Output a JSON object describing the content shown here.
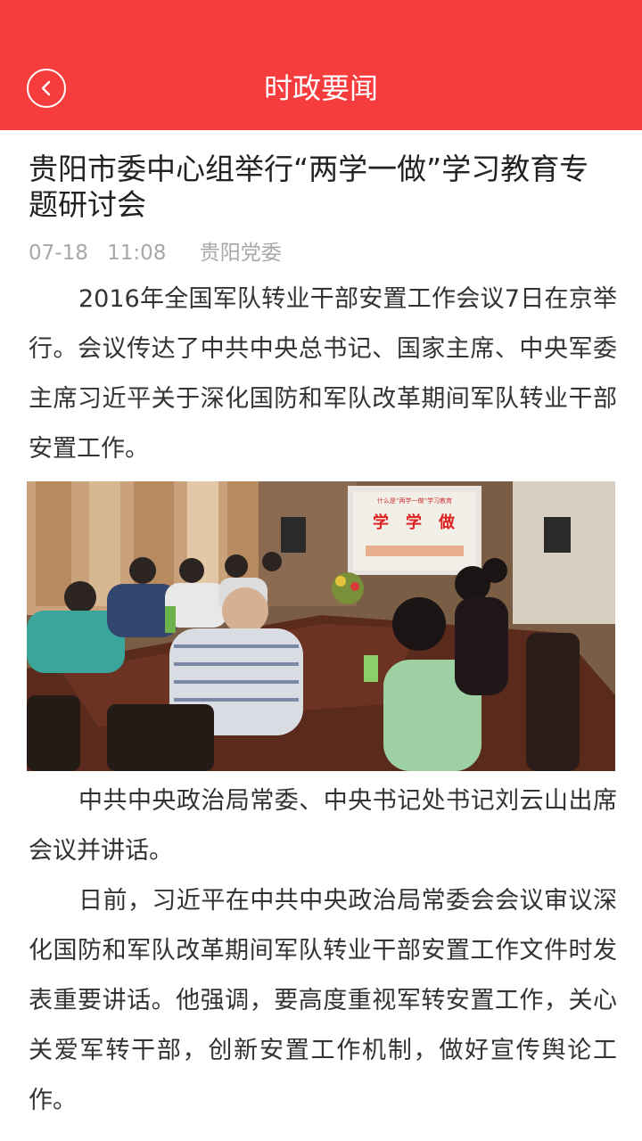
{
  "header": {
    "title": "时政要闻",
    "back_icon": "chevron-left-circle-icon"
  },
  "article": {
    "title": "贵阳市委中心组举行“两学一做”学习教育专题研讨会",
    "date": "07-18",
    "time": "11:08",
    "source": "贵阳党委",
    "paragraphs": [
      "2016年全国军队转业干部安置工作会议7日在京举行。会议传达了中共中央总书记、国家主席、中央军委主席习近平关于深化国防和军队改革期间军队转业干部安置工作。",
      "中共中央政治局常委、中央书记处书记刘云山出席会议并讲话。",
      "日前，习近平在中共中央政治局常委会会议审议深化国防和军队改革期间军队转业干部安置工作文件时发表重要讲话。他强调，要高度重视军转安置工作，关心关爱军转干部，创新安置工作机制，做好宣传舆论工作。"
    ],
    "photo": {
      "screen_heading": "什么是“两学一做”学习教育",
      "screen_words": [
        "学",
        "学",
        "做"
      ]
    }
  },
  "colors": {
    "accent": "#f63c3c",
    "meta_text": "#a8a8a8",
    "body_text": "#333333"
  }
}
